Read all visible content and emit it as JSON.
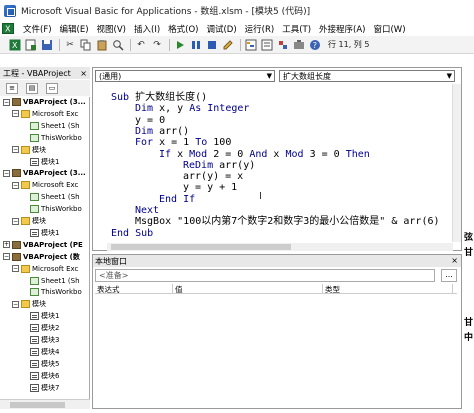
{
  "window": {
    "title": "Microsoft Visual Basic for Applications - 数组.xlsm - [模块5 (代码)]"
  },
  "menu": [
    {
      "label": "文件(F)",
      "name": "menu-file"
    },
    {
      "label": "编辑(E)",
      "name": "menu-edit"
    },
    {
      "label": "视图(V)",
      "name": "menu-view"
    },
    {
      "label": "插入(I)",
      "name": "menu-insert"
    },
    {
      "label": "格式(O)",
      "name": "menu-format"
    },
    {
      "label": "调试(D)",
      "name": "menu-debug"
    },
    {
      "label": "运行(R)",
      "name": "menu-run"
    },
    {
      "label": "工具(T)",
      "name": "menu-tools"
    },
    {
      "label": "外接程序(A)",
      "name": "menu-addins"
    },
    {
      "label": "窗口(W)",
      "name": "menu-window"
    }
  ],
  "toolbar": {
    "status": "行 11, 列 5"
  },
  "project": {
    "title": "工程 - VBAProject",
    "close": "×",
    "tree": [
      {
        "level": 0,
        "toggle": "−",
        "icon": "proj",
        "text": "VBAProject (3...",
        "bold": true
      },
      {
        "level": 1,
        "toggle": "−",
        "icon": "folder",
        "text": "Microsoft Exc"
      },
      {
        "level": 2,
        "toggle": "",
        "icon": "sheet",
        "text": "Sheet1 (Sh"
      },
      {
        "level": 2,
        "toggle": "",
        "icon": "sheet",
        "text": "ThisWorkbo"
      },
      {
        "level": 1,
        "toggle": "−",
        "icon": "folder",
        "text": "模块"
      },
      {
        "level": 2,
        "toggle": "",
        "icon": "mod",
        "text": "模块1"
      },
      {
        "level": 0,
        "toggle": "−",
        "icon": "proj",
        "text": "VBAProject (3...",
        "bold": true
      },
      {
        "level": 1,
        "toggle": "−",
        "icon": "folder",
        "text": "Microsoft Exc"
      },
      {
        "level": 2,
        "toggle": "",
        "icon": "sheet",
        "text": "Sheet1 (Sh"
      },
      {
        "level": 2,
        "toggle": "",
        "icon": "sheet",
        "text": "ThisWorkbo"
      },
      {
        "level": 1,
        "toggle": "−",
        "icon": "folder",
        "text": "模块"
      },
      {
        "level": 2,
        "toggle": "",
        "icon": "mod",
        "text": "模块1"
      },
      {
        "level": 0,
        "toggle": "+",
        "icon": "proj",
        "text": "VBAProject (PE",
        "bold": true
      },
      {
        "level": 0,
        "toggle": "−",
        "icon": "proj",
        "text": "VBAProject (数",
        "bold": true
      },
      {
        "level": 1,
        "toggle": "−",
        "icon": "folder",
        "text": "Microsoft Exc"
      },
      {
        "level": 2,
        "toggle": "",
        "icon": "sheet",
        "text": "Sheet1 (Sh"
      },
      {
        "level": 2,
        "toggle": "",
        "icon": "sheet",
        "text": "ThisWorkbo"
      },
      {
        "level": 1,
        "toggle": "−",
        "icon": "folder",
        "text": "模块"
      },
      {
        "level": 2,
        "toggle": "",
        "icon": "mod",
        "text": "模块1"
      },
      {
        "level": 2,
        "toggle": "",
        "icon": "mod",
        "text": "模块2"
      },
      {
        "level": 2,
        "toggle": "",
        "icon": "mod",
        "text": "模块3"
      },
      {
        "level": 2,
        "toggle": "",
        "icon": "mod",
        "text": "模块4"
      },
      {
        "level": 2,
        "toggle": "",
        "icon": "mod",
        "text": "模块5"
      },
      {
        "level": 2,
        "toggle": "",
        "icon": "mod",
        "text": "模块6"
      },
      {
        "level": 2,
        "toggle": "",
        "icon": "mod",
        "text": "模块7"
      }
    ]
  },
  "code": {
    "object_combo": "(通用)",
    "proc_combo": "扩大数组长度",
    "lines": [
      {
        "indent": 0,
        "parts": [
          {
            "t": "Sub ",
            "k": true
          },
          {
            "t": "扩大数组长度()",
            "k": false
          }
        ]
      },
      {
        "indent": 1,
        "parts": [
          {
            "t": "Dim ",
            "k": true
          },
          {
            "t": "x, y ",
            "k": false
          },
          {
            "t": "As Integer",
            "k": true
          }
        ]
      },
      {
        "indent": 1,
        "parts": [
          {
            "t": "y = 0",
            "k": false
          }
        ]
      },
      {
        "indent": 1,
        "parts": [
          {
            "t": "Dim ",
            "k": true
          },
          {
            "t": "arr()",
            "k": false
          }
        ]
      },
      {
        "indent": 1,
        "parts": [
          {
            "t": "For ",
            "k": true
          },
          {
            "t": "x = 1 ",
            "k": false
          },
          {
            "t": "To ",
            "k": true
          },
          {
            "t": "100",
            "k": false
          }
        ]
      },
      {
        "indent": 2,
        "parts": [
          {
            "t": "If ",
            "k": true
          },
          {
            "t": "x ",
            "k": false
          },
          {
            "t": "Mod ",
            "k": true
          },
          {
            "t": "2 = 0 ",
            "k": false
          },
          {
            "t": "And ",
            "k": true
          },
          {
            "t": "x ",
            "k": false
          },
          {
            "t": "Mod ",
            "k": true
          },
          {
            "t": "3 = 0 ",
            "k": false
          },
          {
            "t": "Then",
            "k": true
          }
        ]
      },
      {
        "indent": 3,
        "parts": [
          {
            "t": "ReDim ",
            "k": true
          },
          {
            "t": "arr(y)",
            "k": false
          }
        ]
      },
      {
        "indent": 3,
        "parts": [
          {
            "t": "arr(y) = x",
            "k": false
          }
        ]
      },
      {
        "indent": 3,
        "parts": [
          {
            "t": "y = y + 1",
            "k": false
          }
        ]
      },
      {
        "indent": 2,
        "parts": [
          {
            "t": "End If",
            "k": true
          }
        ]
      },
      {
        "indent": 1,
        "parts": [
          {
            "t": "Next",
            "k": true
          }
        ]
      },
      {
        "indent": 1,
        "parts": [
          {
            "t": "MsgBox ",
            "k": false
          },
          {
            "t": "\"100以内第7个数字2和数字3的最小公倍数是\" & arr(6)",
            "k": false
          }
        ]
      },
      {
        "indent": 0,
        "parts": [
          {
            "t": "End Sub",
            "k": true
          }
        ]
      }
    ]
  },
  "locals": {
    "title": "本地窗口",
    "close": "×",
    "status": "<准备>",
    "dots": "...",
    "columns": [
      "表达式",
      "值",
      "类型"
    ]
  },
  "right_edge": [
    "弦",
    "甘",
    "甘",
    "中"
  ]
}
